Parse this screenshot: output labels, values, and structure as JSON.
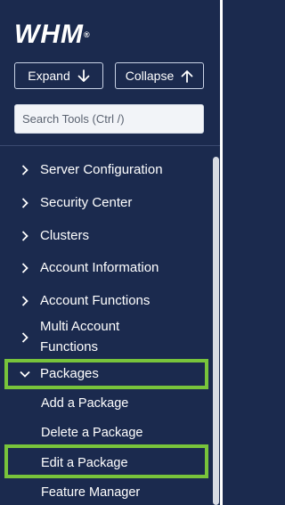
{
  "brand": {
    "logo_text": "WHM",
    "trademark": "®"
  },
  "toolbar": {
    "expand_label": "Expand",
    "collapse_label": "Collapse"
  },
  "search": {
    "placeholder": "Search Tools (Ctrl /)",
    "value": ""
  },
  "nav": {
    "items": [
      {
        "label": "Server Configuration",
        "expanded": false
      },
      {
        "label": "Security Center",
        "expanded": false
      },
      {
        "label": "Clusters",
        "expanded": false
      },
      {
        "label": "Account Information",
        "expanded": false
      },
      {
        "label": "Account Functions",
        "expanded": false
      },
      {
        "label_line1": "Multi Account",
        "label_line2": "Functions",
        "expanded": false
      },
      {
        "label": "Packages",
        "expanded": true
      }
    ],
    "packages_subitems": [
      {
        "label": "Add a Package"
      },
      {
        "label": "Delete a Package"
      },
      {
        "label": "Edit a Package"
      },
      {
        "label": "Feature Manager"
      }
    ]
  },
  "colors": {
    "sidebar_bg": "#1b2a4e",
    "highlight": "#78c43b"
  }
}
